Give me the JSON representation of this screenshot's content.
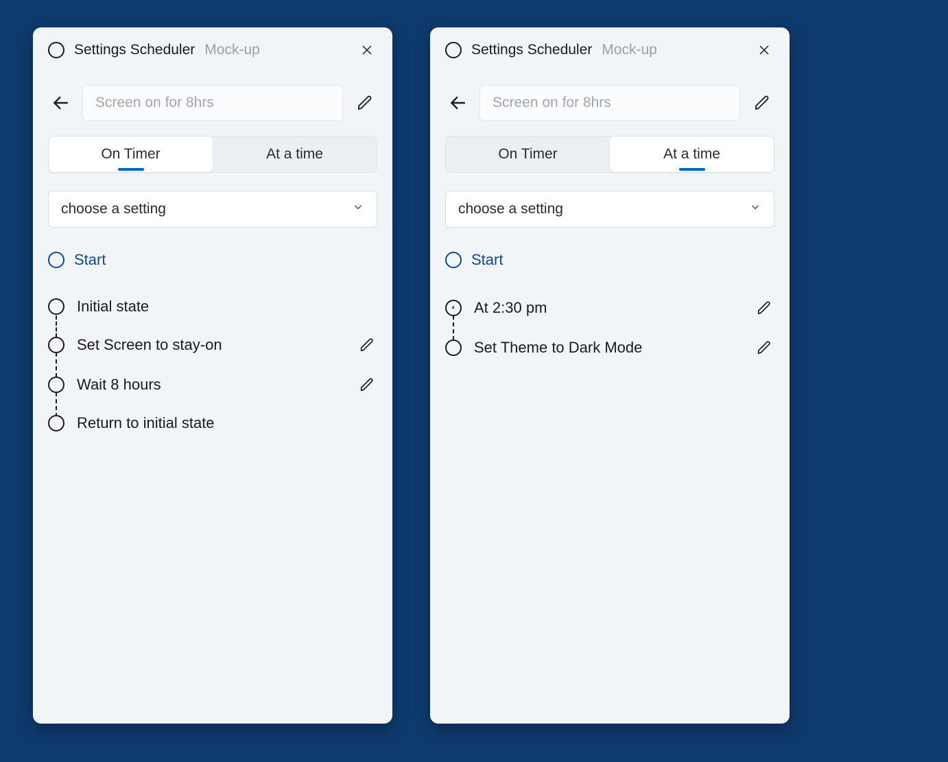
{
  "left": {
    "title": "Settings Scheduler",
    "subtitle": "Mock-up",
    "name_placeholder": "Screen on for 8hrs",
    "tabs": {
      "on_timer": "On Timer",
      "at_time": "At a time"
    },
    "active_tab": "on_timer",
    "setting_select": "choose a setting",
    "start_label": "Start",
    "steps": [
      {
        "label": "Initial state",
        "editable": false,
        "icon": "circle"
      },
      {
        "label": "Set Screen to stay-on",
        "editable": true,
        "icon": "circle"
      },
      {
        "label": "Wait 8 hours",
        "editable": true,
        "icon": "circle"
      },
      {
        "label": "Return to initial state",
        "editable": false,
        "icon": "circle"
      }
    ]
  },
  "right": {
    "title": "Settings Scheduler",
    "subtitle": "Mock-up",
    "name_placeholder": "Screen on for 8hrs",
    "tabs": {
      "on_timer": "On Timer",
      "at_time": "At a time"
    },
    "active_tab": "at_time",
    "setting_select": "choose a setting",
    "start_label": "Start",
    "steps": [
      {
        "label": "At 2:30 pm",
        "editable": true,
        "icon": "clock"
      },
      {
        "label": "Set Theme to Dark Mode",
        "editable": true,
        "icon": "circle"
      }
    ]
  }
}
